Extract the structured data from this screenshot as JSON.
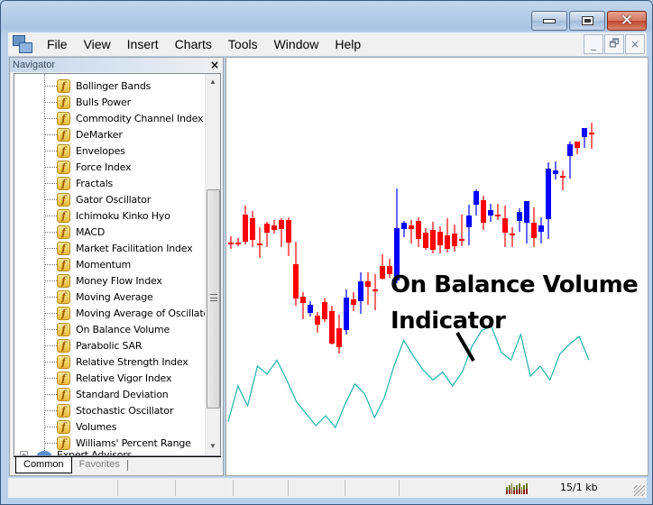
{
  "window": {
    "caption_buttons": [
      "minimize",
      "maximize",
      "close"
    ]
  },
  "menubar": {
    "items": [
      "File",
      "View",
      "Insert",
      "Charts",
      "Tools",
      "Window",
      "Help"
    ],
    "mdi_buttons": [
      "_",
      "🗗",
      "×"
    ]
  },
  "navigator": {
    "title": "Navigator",
    "close_label": "×",
    "indicators": [
      "Bollinger Bands",
      "Bulls Power",
      "Commodity Channel Index",
      "DeMarker",
      "Envelopes",
      "Force Index",
      "Fractals",
      "Gator Oscillator",
      "Ichimoku Kinko Hyo",
      "MACD",
      "Market Facilitation Index",
      "Momentum",
      "Money Flow Index",
      "Moving Average",
      "Moving Average of Oscillator",
      "On Balance Volume",
      "Parabolic SAR",
      "Relative Strength Index",
      "Relative Vigor Index",
      "Standard Deviation",
      "Stochastic Oscillator",
      "Volumes",
      "Williams' Percent Range"
    ],
    "indicator_icon": "function-icon",
    "expert_advisors_label": "Expert Advisors",
    "tabs": [
      "Common",
      "Favorites"
    ],
    "active_tab": "Common"
  },
  "chart": {
    "annotation_line1": "On Balance Volume",
    "annotation_line2": "Indicator",
    "colors": {
      "bull": "#0000ff",
      "bear": "#ff0000",
      "obv": "#20b2aa",
      "pointer": "#000000"
    },
    "candles": [
      {
        "o": 0,
        "c": 0,
        "h": 7,
        "l": -7
      },
      {
        "o": 0,
        "c": 0,
        "h": 5,
        "l": -4
      },
      {
        "o": -4,
        "c": 28,
        "h": 40,
        "l": -7
      },
      {
        "o": 28,
        "c": 4,
        "h": 32,
        "l": -3
      },
      {
        "o": -2,
        "c": -2,
        "h": 19,
        "l": -22
      },
      {
        "o": 0,
        "c": 10,
        "h": 24,
        "l": -2
      },
      {
        "o": 10,
        "c": 4,
        "h": 14,
        "l": 1
      },
      {
        "o": 4,
        "c": 14,
        "h": 17,
        "l": -14
      },
      {
        "o": 14,
        "c": -8,
        "h": 16,
        "l": -18
      },
      {
        "o": -8,
        "c": -47,
        "h": -6,
        "l": -54
      },
      {
        "o": -47,
        "c": -54,
        "h": -43,
        "l": -70
      },
      {
        "o": -54,
        "c": -64,
        "h": -50,
        "l": -67
      },
      {
        "o": -64,
        "c": -73,
        "h": -61,
        "l": -82
      },
      {
        "o": -73,
        "c": -58,
        "h": -54,
        "l": -76
      },
      {
        "o": -58,
        "c": -92,
        "h": -55,
        "l": -94
      },
      {
        "o": -88,
        "c": -74,
        "h": -71,
        "l": -97
      },
      {
        "o": -80,
        "c": -45,
        "h": -37,
        "l": -80
      },
      {
        "o": -45,
        "c": -40,
        "h": -32,
        "l": -50
      },
      {
        "o": -39,
        "c": -22,
        "h": -17,
        "l": -50
      },
      {
        "o": -20,
        "c": -26,
        "h": -16,
        "l": -41
      },
      {
        "o": -26,
        "c": -26,
        "h": -13,
        "l": -41
      },
      {
        "o": -4,
        "c": 7,
        "h": 16,
        "l": 4
      },
      {
        "o": -2,
        "c": -2,
        "h": 18,
        "l": -3
      },
      {
        "o": -3,
        "c": 73,
        "h": 73,
        "l": -8
      }
    ],
    "candles2": [
      {
        "o": 0,
        "c": 0,
        "h": 0,
        "l": 0
      }
    ],
    "obv": [
      12,
      30,
      20,
      40,
      36,
      43,
      33,
      22,
      16,
      10,
      15,
      9,
      21,
      31,
      26,
      14,
      24,
      40,
      53,
      45,
      38,
      33,
      37,
      30,
      37,
      50,
      58,
      60,
      47,
      43,
      56,
      35,
      40,
      33,
      46,
      51,
      55,
      43
    ]
  },
  "statusbar": {
    "connection_icon": "connection-bars-icon",
    "traffic": "15/1 kb"
  }
}
